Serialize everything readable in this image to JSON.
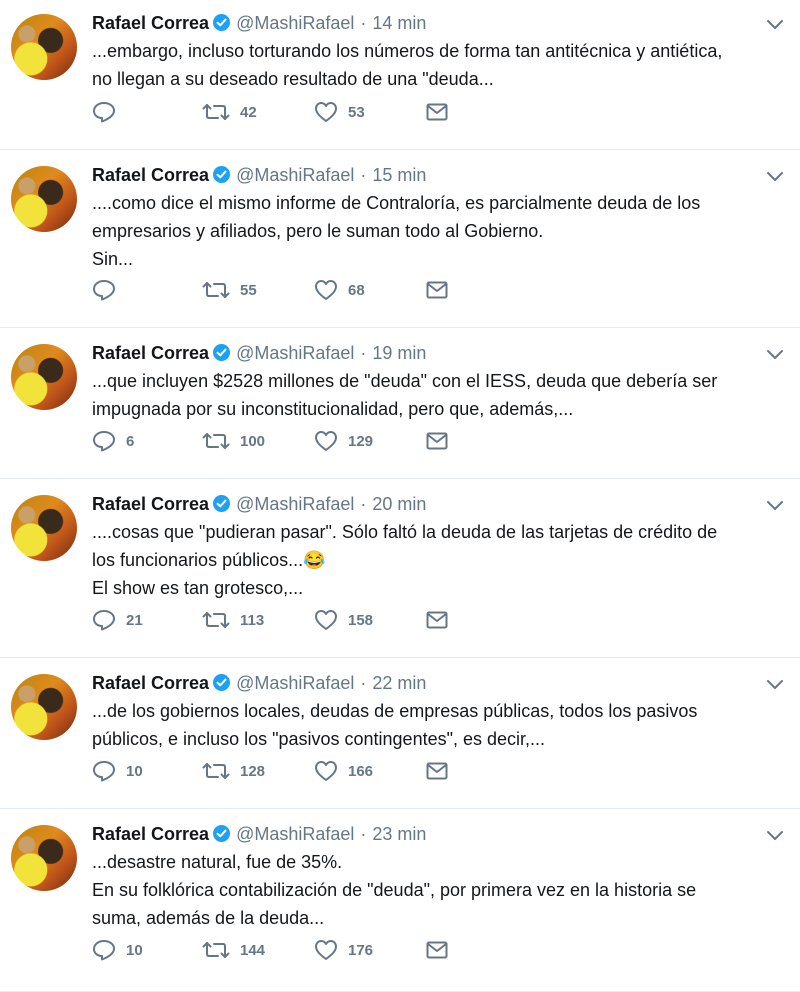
{
  "tweets": [
    {
      "name": "Rafael Correa",
      "handle": "@MashiRafael",
      "separator": "·",
      "time": "14 min",
      "lines": [
        "...embargo, incluso torturando los números de forma tan antitécnica y antiética,",
        "no llegan a su deseado resultado de una \"deuda..."
      ],
      "replies": "",
      "retweets": "42",
      "likes": "53"
    },
    {
      "name": "Rafael Correa",
      "handle": "@MashiRafael",
      "separator": "·",
      "time": "15 min",
      "lines": [
        "....como dice el mismo informe de Contraloría, es parcialmente deuda de los",
        "empresarios y afiliados, pero le suman todo al Gobierno.",
        "Sin..."
      ],
      "replies": "",
      "retweets": "55",
      "likes": "68"
    },
    {
      "name": "Rafael Correa",
      "handle": "@MashiRafael",
      "separator": "·",
      "time": "19 min",
      "lines": [
        "...que incluyen $2528 millones de \"deuda\" con el IESS, deuda que debería ser",
        "impugnada por su inconstitucionalidad, pero que, además,..."
      ],
      "replies": "6",
      "retweets": "100",
      "likes": "129"
    },
    {
      "name": "Rafael Correa",
      "handle": "@MashiRafael",
      "separator": "·",
      "time": "20 min",
      "lines": [
        "....cosas que \"pudieran pasar\". Sólo faltó la deuda de las tarjetas de  crédito de",
        "los funcionarios públicos...😂",
        "El show es tan grotesco,..."
      ],
      "replies": "21",
      "retweets": "113",
      "likes": "158"
    },
    {
      "name": "Rafael Correa",
      "handle": "@MashiRafael",
      "separator": "·",
      "time": "22 min",
      "lines": [
        "...de los gobiernos locales, deudas de empresas públicas, todos los pasivos",
        "públicos, e incluso los \"pasivos contingentes\", es decir,..."
      ],
      "replies": "10",
      "retweets": "128",
      "likes": "166"
    },
    {
      "name": "Rafael Correa",
      "handle": "@MashiRafael",
      "separator": "·",
      "time": "23 min",
      "lines": [
        "...desastre natural, fue de 35%.",
        "En su folklórica contabilización de \"deuda\", por primera vez en la historia se",
        "suma, además de la deuda..."
      ],
      "replies": "10",
      "retweets": "144",
      "likes": "176"
    }
  ],
  "icons": {
    "verified": "verified-badge-icon",
    "more": "chevron-down-icon",
    "reply": "reply-icon",
    "retweet": "retweet-icon",
    "like": "heart-icon",
    "dm": "envelope-icon"
  },
  "colors": {
    "text": "#14171a",
    "secondary": "#657786",
    "verified": "#1da1f2",
    "divider": "#e6ecf0"
  }
}
